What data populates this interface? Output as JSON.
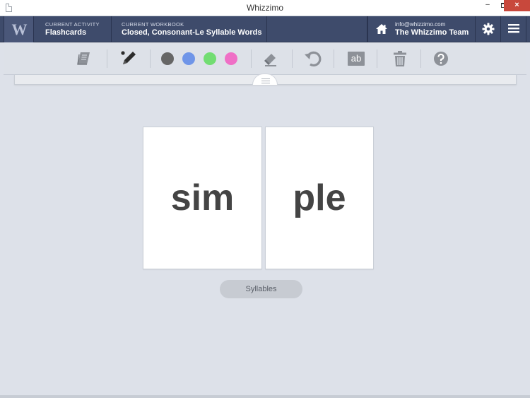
{
  "window": {
    "title": "Whizzimo",
    "minimize": "–",
    "close": "×"
  },
  "header": {
    "logo": "W",
    "current_activity": {
      "label": "CURRENT ACTIVITY",
      "value": "Flashcards"
    },
    "current_workbook": {
      "label": "CURRENT WORKBOOK",
      "value": "Closed, Consonant-Le Syllable Words"
    },
    "account": {
      "email": "info@whizzimo.com",
      "name": "The Whizzimo Team"
    }
  },
  "toolbar": {
    "text_tool_label": "ab",
    "pen_colors": [
      "#666666",
      "#6f95e8",
      "#72dd72",
      "#ef6fc6"
    ]
  },
  "cards": [
    {
      "text": "sim"
    },
    {
      "text": "ple"
    }
  ],
  "syllables_button": {
    "label": "Syllables"
  }
}
